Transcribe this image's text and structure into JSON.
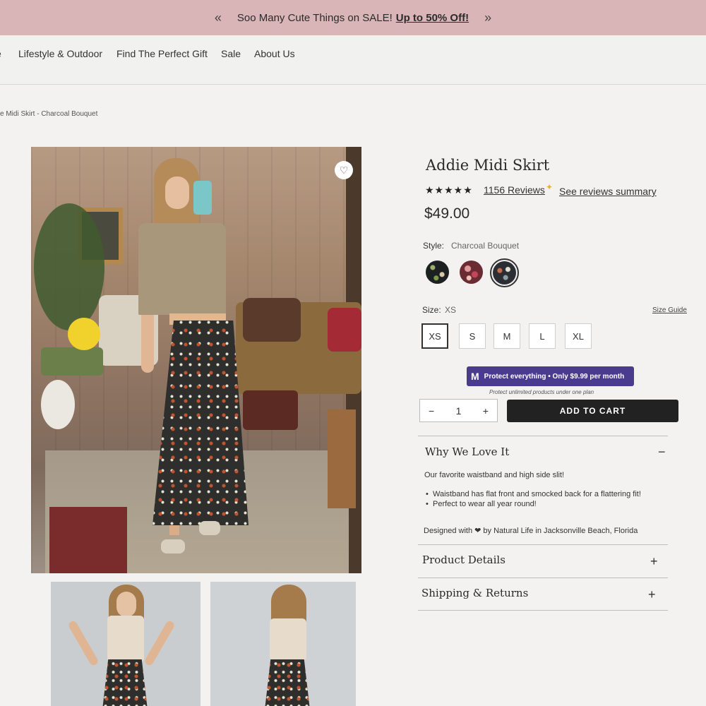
{
  "promo": {
    "prev_icon": "«",
    "next_icon": "»",
    "text": "Soo Many Cute Things on SALE!",
    "link": "Up to 50% Off!"
  },
  "nav": {
    "items": [
      "Lifestyle & Outdoor",
      "Find The Perfect Gift",
      "Sale",
      "About Us"
    ]
  },
  "breadcrumb": "e Midi Skirt - Charcoal Bouquet",
  "product": {
    "title": "Addie Midi Skirt",
    "stars": "★★★★★",
    "reviews": "1156 Reviews",
    "reviews_summary": "See reviews summary",
    "price": "$49.00",
    "style_label": "Style:",
    "style_value": "Charcoal Bouquet",
    "size_label": "Size:",
    "size_value": "XS",
    "size_guide": "Size Guide",
    "sizes": [
      "XS",
      "S",
      "M",
      "L",
      "XL"
    ],
    "selected_size": "XS",
    "protect": {
      "icon": "M",
      "text": "Protect everything • Only $9.99 per month",
      "subtext": "Protect unlimited products under one plan"
    },
    "quantity": {
      "minus": "−",
      "value": "1",
      "plus": "+"
    },
    "add_to_cart": "ADD TO CART"
  },
  "accordion": {
    "why": {
      "title": "Why We Love It",
      "icon": "−",
      "intro": "Our favorite waistband and high side slit!",
      "bullets": [
        "Waistband has flat front and smocked back for a flattering fit!",
        "Perfect to wear all year round!"
      ],
      "designed": "Designed with ❤ by Natural Life in Jacksonville Beach, Florida"
    },
    "details": {
      "title": "Product Details",
      "icon": "+"
    },
    "shipping": {
      "title": "Shipping & Returns",
      "icon": "+"
    }
  },
  "icons": {
    "heart": "♡",
    "sparkle": "✦"
  },
  "colors": {
    "promo_bg": "#d9b5b8",
    "protect_bg": "#4a3b8f",
    "cart_bg": "#222222"
  }
}
